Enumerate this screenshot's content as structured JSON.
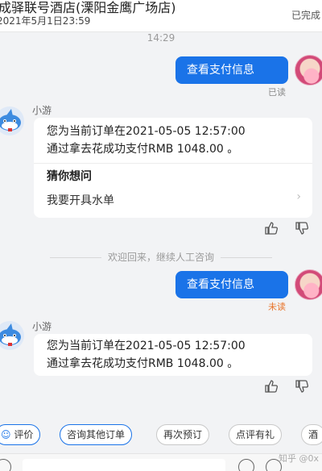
{
  "header": {
    "title": "成驿联号酒店(溧阳金鹰广场店)",
    "date": "2021年5月1日23:59",
    "status": "已完成"
  },
  "chat": {
    "time_separator": "14:29",
    "user_message": "查看支付信息",
    "read_status": "已读",
    "unread_status": "未读",
    "bot_name": "小游",
    "payment_message_line1": "您为当前订单在2021-05-05 12:57:00",
    "payment_message_line2": "通过拿去花成功支付RMB 1048.00 。",
    "guess_title": "猜你想问",
    "suggestion": "我要开具水单",
    "welcome_back": "欢迎回来，继续人工咨询"
  },
  "quick_actions": {
    "chips": [
      "评价",
      "咨询其他订单",
      "再次预订",
      "点评有礼",
      "酒"
    ]
  },
  "watermark": "知乎 @0x"
}
